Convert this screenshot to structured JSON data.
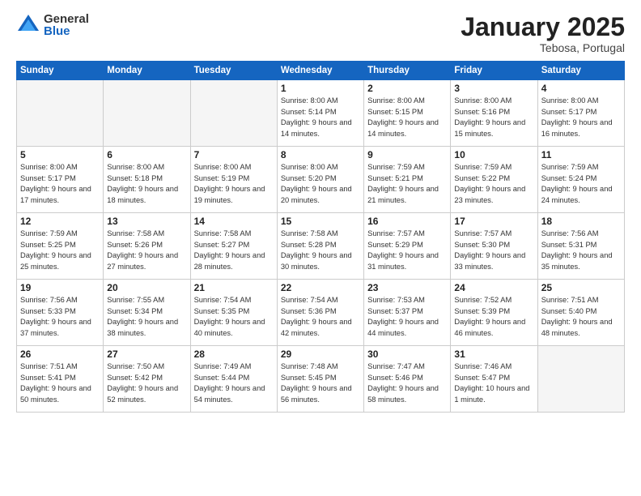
{
  "header": {
    "logo_general": "General",
    "logo_blue": "Blue",
    "month_title": "January 2025",
    "location": "Tebosa, Portugal"
  },
  "weekdays": [
    "Sunday",
    "Monday",
    "Tuesday",
    "Wednesday",
    "Thursday",
    "Friday",
    "Saturday"
  ],
  "weeks": [
    [
      {
        "day": "",
        "empty": true
      },
      {
        "day": "",
        "empty": true
      },
      {
        "day": "",
        "empty": true
      },
      {
        "day": "1",
        "sunrise": "8:00 AM",
        "sunset": "5:14 PM",
        "daylight": "9 hours and 14 minutes."
      },
      {
        "day": "2",
        "sunrise": "8:00 AM",
        "sunset": "5:15 PM",
        "daylight": "9 hours and 14 minutes."
      },
      {
        "day": "3",
        "sunrise": "8:00 AM",
        "sunset": "5:16 PM",
        "daylight": "9 hours and 15 minutes."
      },
      {
        "day": "4",
        "sunrise": "8:00 AM",
        "sunset": "5:17 PM",
        "daylight": "9 hours and 16 minutes."
      }
    ],
    [
      {
        "day": "5",
        "sunrise": "8:00 AM",
        "sunset": "5:17 PM",
        "daylight": "9 hours and 17 minutes."
      },
      {
        "day": "6",
        "sunrise": "8:00 AM",
        "sunset": "5:18 PM",
        "daylight": "9 hours and 18 minutes."
      },
      {
        "day": "7",
        "sunrise": "8:00 AM",
        "sunset": "5:19 PM",
        "daylight": "9 hours and 19 minutes."
      },
      {
        "day": "8",
        "sunrise": "8:00 AM",
        "sunset": "5:20 PM",
        "daylight": "9 hours and 20 minutes."
      },
      {
        "day": "9",
        "sunrise": "7:59 AM",
        "sunset": "5:21 PM",
        "daylight": "9 hours and 21 minutes."
      },
      {
        "day": "10",
        "sunrise": "7:59 AM",
        "sunset": "5:22 PM",
        "daylight": "9 hours and 23 minutes."
      },
      {
        "day": "11",
        "sunrise": "7:59 AM",
        "sunset": "5:24 PM",
        "daylight": "9 hours and 24 minutes."
      }
    ],
    [
      {
        "day": "12",
        "sunrise": "7:59 AM",
        "sunset": "5:25 PM",
        "daylight": "9 hours and 25 minutes."
      },
      {
        "day": "13",
        "sunrise": "7:58 AM",
        "sunset": "5:26 PM",
        "daylight": "9 hours and 27 minutes."
      },
      {
        "day": "14",
        "sunrise": "7:58 AM",
        "sunset": "5:27 PM",
        "daylight": "9 hours and 28 minutes."
      },
      {
        "day": "15",
        "sunrise": "7:58 AM",
        "sunset": "5:28 PM",
        "daylight": "9 hours and 30 minutes."
      },
      {
        "day": "16",
        "sunrise": "7:57 AM",
        "sunset": "5:29 PM",
        "daylight": "9 hours and 31 minutes."
      },
      {
        "day": "17",
        "sunrise": "7:57 AM",
        "sunset": "5:30 PM",
        "daylight": "9 hours and 33 minutes."
      },
      {
        "day": "18",
        "sunrise": "7:56 AM",
        "sunset": "5:31 PM",
        "daylight": "9 hours and 35 minutes."
      }
    ],
    [
      {
        "day": "19",
        "sunrise": "7:56 AM",
        "sunset": "5:33 PM",
        "daylight": "9 hours and 37 minutes."
      },
      {
        "day": "20",
        "sunrise": "7:55 AM",
        "sunset": "5:34 PM",
        "daylight": "9 hours and 38 minutes."
      },
      {
        "day": "21",
        "sunrise": "7:54 AM",
        "sunset": "5:35 PM",
        "daylight": "9 hours and 40 minutes."
      },
      {
        "day": "22",
        "sunrise": "7:54 AM",
        "sunset": "5:36 PM",
        "daylight": "9 hours and 42 minutes."
      },
      {
        "day": "23",
        "sunrise": "7:53 AM",
        "sunset": "5:37 PM",
        "daylight": "9 hours and 44 minutes."
      },
      {
        "day": "24",
        "sunrise": "7:52 AM",
        "sunset": "5:39 PM",
        "daylight": "9 hours and 46 minutes."
      },
      {
        "day": "25",
        "sunrise": "7:51 AM",
        "sunset": "5:40 PM",
        "daylight": "9 hours and 48 minutes."
      }
    ],
    [
      {
        "day": "26",
        "sunrise": "7:51 AM",
        "sunset": "5:41 PM",
        "daylight": "9 hours and 50 minutes."
      },
      {
        "day": "27",
        "sunrise": "7:50 AM",
        "sunset": "5:42 PM",
        "daylight": "9 hours and 52 minutes."
      },
      {
        "day": "28",
        "sunrise": "7:49 AM",
        "sunset": "5:44 PM",
        "daylight": "9 hours and 54 minutes."
      },
      {
        "day": "29",
        "sunrise": "7:48 AM",
        "sunset": "5:45 PM",
        "daylight": "9 hours and 56 minutes."
      },
      {
        "day": "30",
        "sunrise": "7:47 AM",
        "sunset": "5:46 PM",
        "daylight": "9 hours and 58 minutes."
      },
      {
        "day": "31",
        "sunrise": "7:46 AM",
        "sunset": "5:47 PM",
        "daylight": "10 hours and 1 minute."
      },
      {
        "day": "",
        "empty": true
      }
    ]
  ]
}
